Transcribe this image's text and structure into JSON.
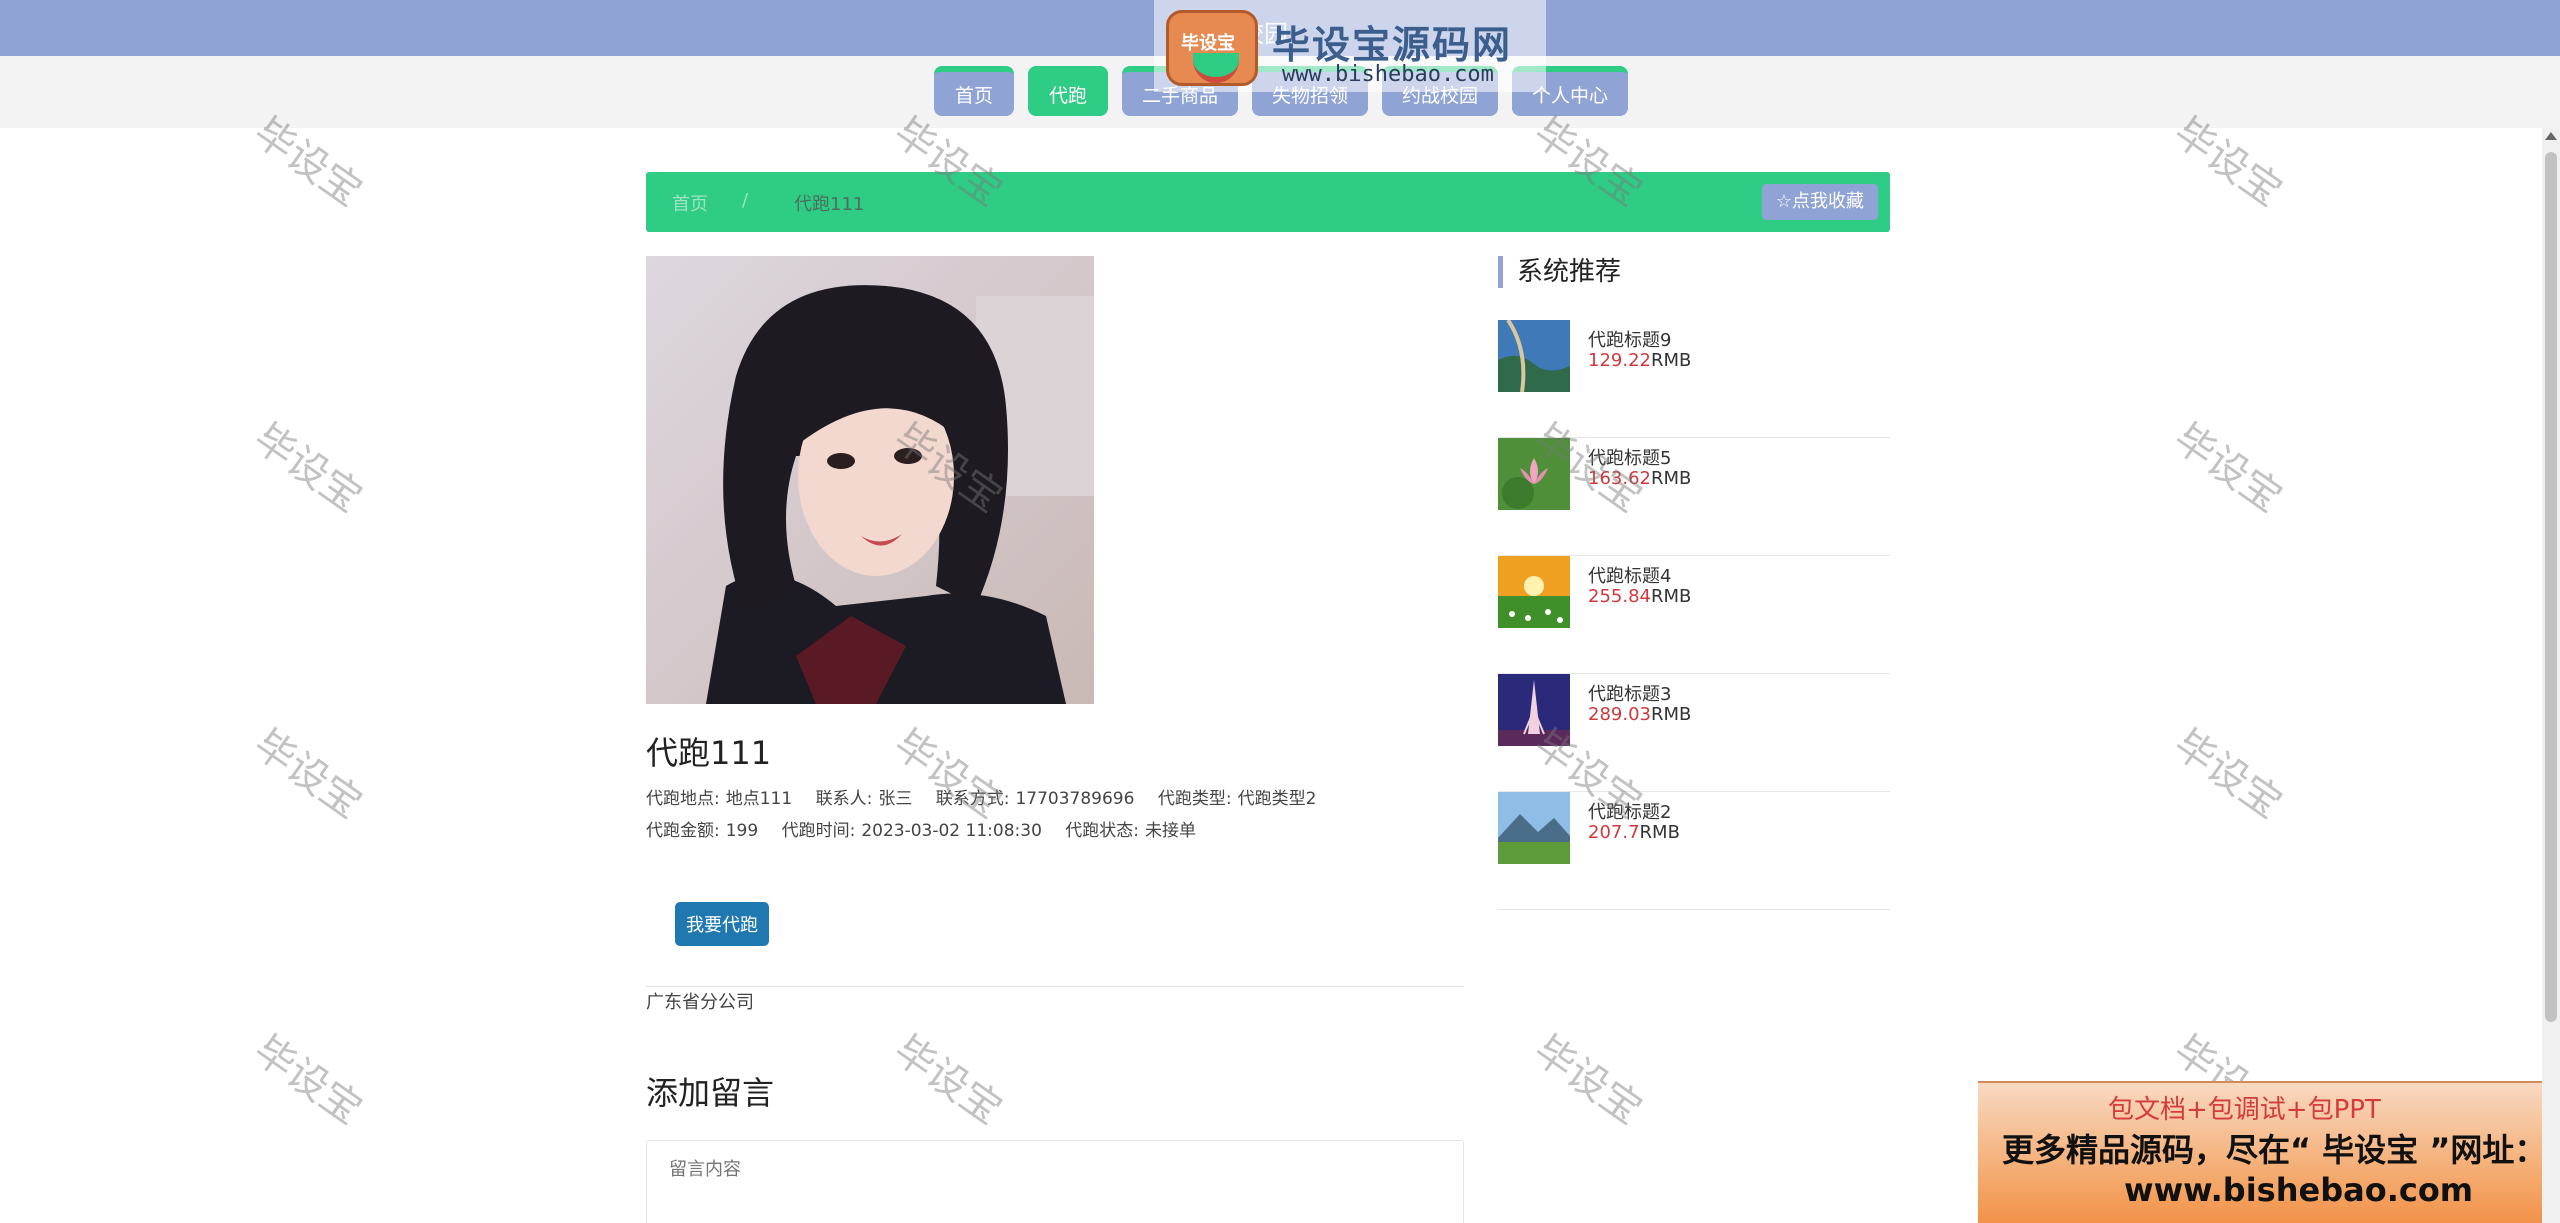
{
  "top_strip": {
    "title": "校园"
  },
  "logo": {
    "badge_text": "毕设宝",
    "title": "毕设宝源码网",
    "url": "www.bishebao.com"
  },
  "nav": {
    "items": [
      {
        "label": "首页",
        "active": false
      },
      {
        "label": "代跑",
        "active": true
      },
      {
        "label": "二手商品",
        "active": false
      },
      {
        "label": "失物招领",
        "active": false
      },
      {
        "label": "约战校园",
        "active": false
      },
      {
        "label": "个人中心",
        "active": false
      }
    ]
  },
  "breadcrumb": {
    "home": "首页",
    "separator": "/",
    "current": "代跑111",
    "fav_label": "☆点我收藏"
  },
  "detail": {
    "title": "代跑111",
    "line1": [
      {
        "label": "代跑地点:",
        "value": "地点111"
      },
      {
        "label": "联系人:",
        "value": "张三"
      },
      {
        "label": "联系方式:",
        "value": "17703789696"
      },
      {
        "label": "代跑类型:",
        "value": "代跑类型2"
      }
    ],
    "line2": [
      {
        "label": "代跑金额:",
        "value": "199"
      },
      {
        "label": "代跑时间:",
        "value": "2023-03-02 11:08:30"
      },
      {
        "label": "代跑状态:",
        "value": "未接单"
      }
    ],
    "take_button": "我要代跑",
    "company": "广东省分公司"
  },
  "comment": {
    "heading": "添加留言",
    "placeholder": "留言内容"
  },
  "sidebar": {
    "heading": "系统推荐",
    "items": [
      {
        "name": "代跑标题9",
        "price": "129.22",
        "unit": "RMB"
      },
      {
        "name": "代跑标题5",
        "price": "163.62",
        "unit": "RMB"
      },
      {
        "name": "代跑标题4",
        "price": "255.84",
        "unit": "RMB"
      },
      {
        "name": "代跑标题3",
        "price": "289.03",
        "unit": "RMB"
      },
      {
        "name": "代跑标题2",
        "price": "207.7",
        "unit": "RMB"
      }
    ]
  },
  "watermark_text": "毕设宝",
  "promo": {
    "line1": "包文档+包调试+包PPT",
    "line2": "更多精品源码，尽在“ 毕设宝 ”网址：",
    "line3": "www.bishebao.com"
  },
  "colors": {
    "primary_green": "#2ecc85",
    "nav_blue": "#8fa3d4",
    "price_red": "#d0393b",
    "button_blue": "#2078b0"
  }
}
